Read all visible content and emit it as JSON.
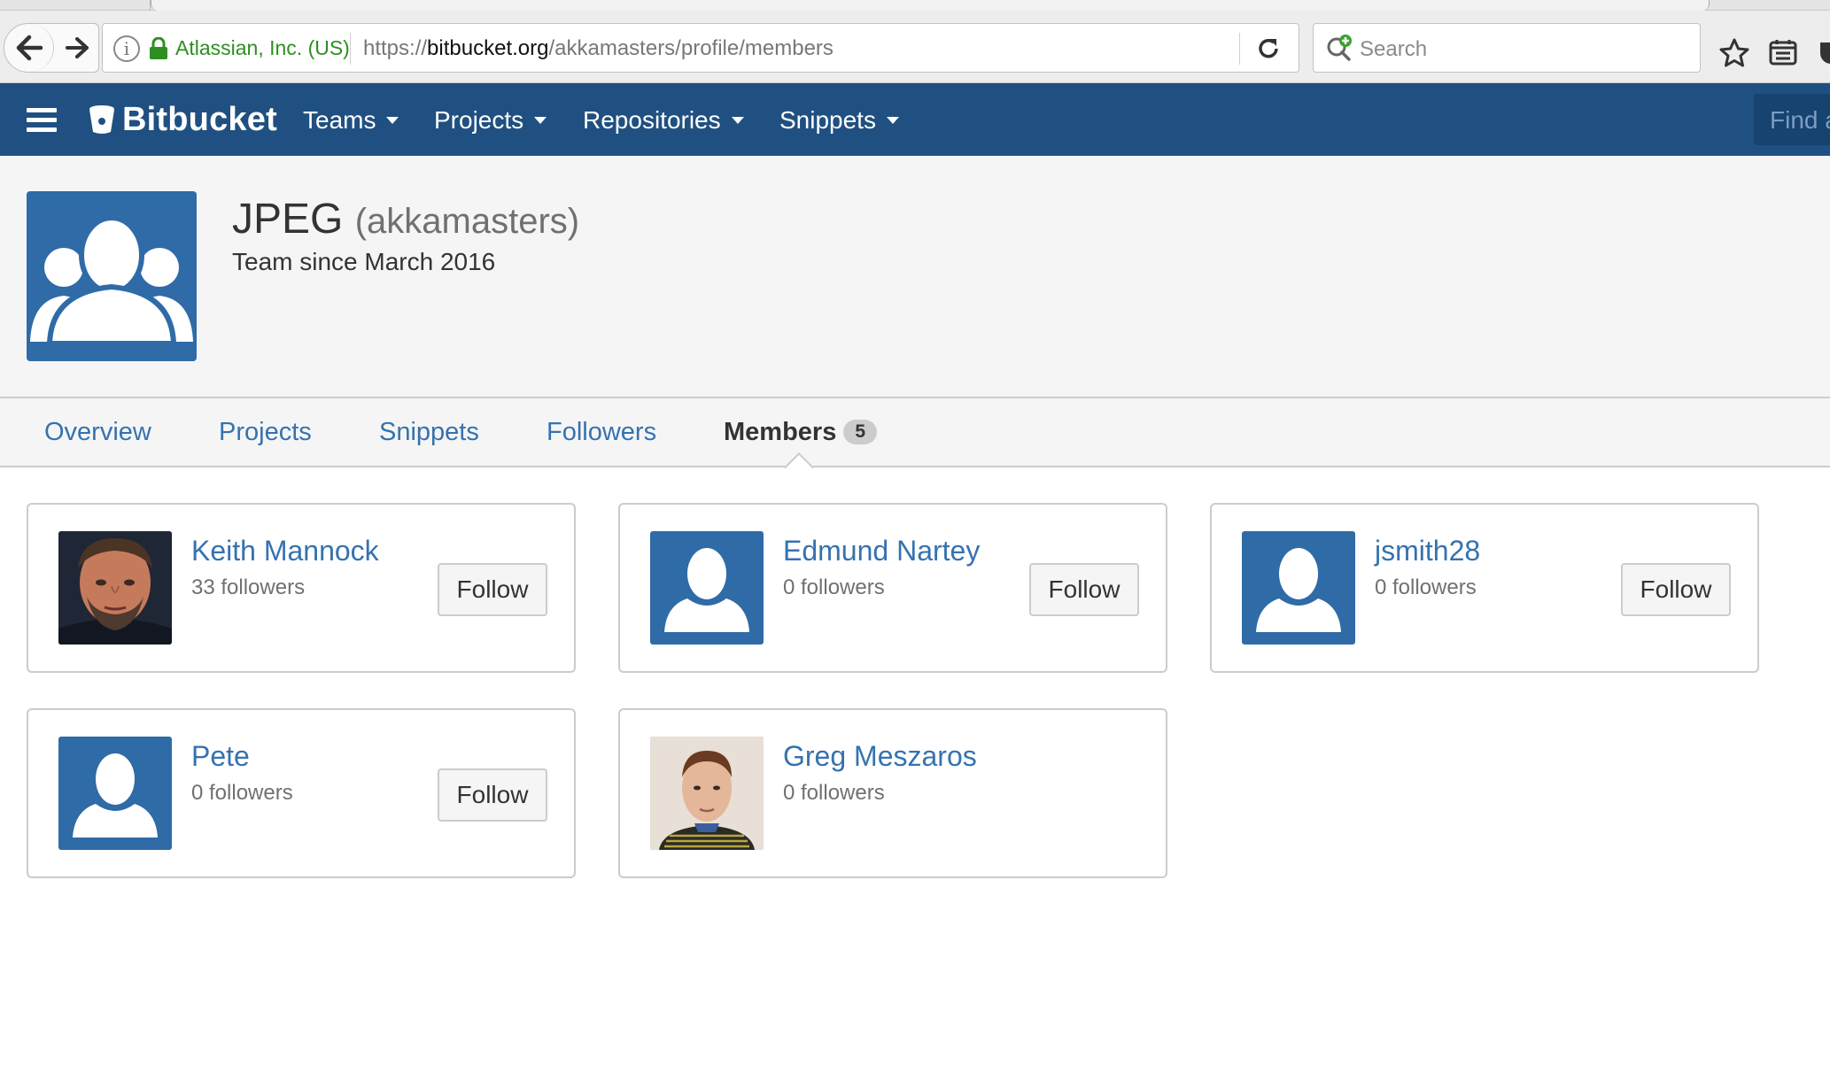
{
  "browser": {
    "site_identity": "Atlassian, Inc. (US)",
    "url_prefix": "https://",
    "url_domain": "bitbucket.org",
    "url_path": "/akkamasters/profile/members",
    "search_placeholder": "Search"
  },
  "nav": {
    "logo_text": "Bitbucket",
    "menu": [
      {
        "label": "Teams"
      },
      {
        "label": "Projects"
      },
      {
        "label": "Repositories"
      },
      {
        "label": "Snippets"
      }
    ],
    "find_placeholder": "Find a"
  },
  "profile": {
    "name": "JPEG",
    "handle": "(akkamasters)",
    "since": "Team since March 2016"
  },
  "tabs": [
    {
      "label": "Overview",
      "active": false
    },
    {
      "label": "Projects",
      "active": false
    },
    {
      "label": "Snippets",
      "active": false
    },
    {
      "label": "Followers",
      "active": false
    },
    {
      "label": "Members",
      "active": true,
      "count": "5"
    }
  ],
  "members": [
    {
      "name": "Keith Mannock",
      "followers": "33 followers",
      "button": "Follow",
      "avatar": "photo"
    },
    {
      "name": "Edmund Nartey",
      "followers": "0 followers",
      "button": "Follow",
      "avatar": "default"
    },
    {
      "name": "jsmith28",
      "followers": "0 followers",
      "button": "Follow",
      "avatar": "default"
    },
    {
      "name": "Pete",
      "followers": "0 followers",
      "button": "Follow",
      "avatar": "default"
    },
    {
      "name": "Greg Meszaros",
      "followers": "0 followers",
      "avatar": "photo"
    }
  ],
  "colors": {
    "nav_bg": "#205081",
    "link": "#3572b0",
    "avatar_bg": "#2f6ba7",
    "page_bg": "#f5f5f5"
  }
}
